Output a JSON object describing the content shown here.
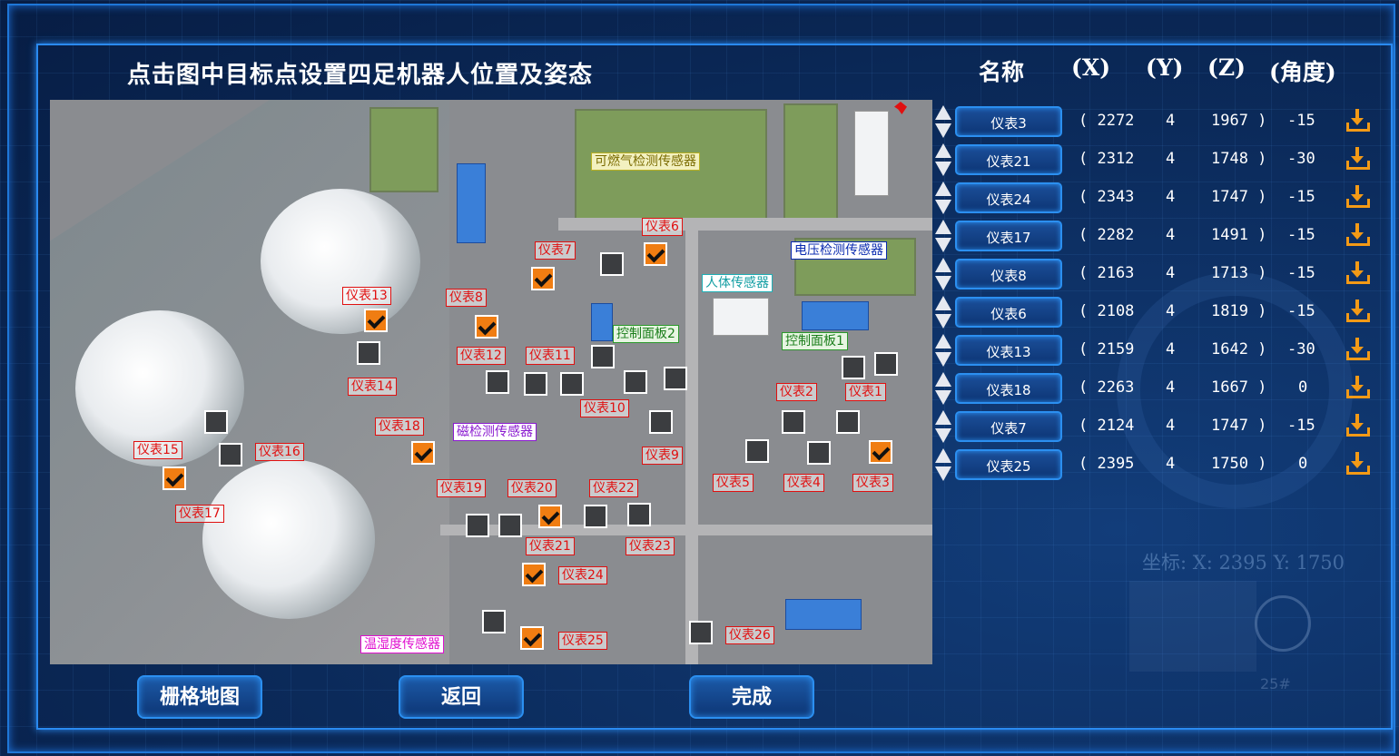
{
  "title": "点击图中目标点设置四足机器人位置及姿态",
  "table_headers": [
    "名称",
    "(X)",
    "(Y)",
    "(Z)",
    "(角度)"
  ],
  "rows": [
    {
      "name": "仪表3",
      "x": "( 2272",
      "y": "4",
      "z": "1967 )",
      "angle": "-15"
    },
    {
      "name": "仪表21",
      "x": "( 2312",
      "y": "4",
      "z": "1748 )",
      "angle": "-30"
    },
    {
      "name": "仪表24",
      "x": "( 2343",
      "y": "4",
      "z": "1747 )",
      "angle": "-15"
    },
    {
      "name": "仪表17",
      "x": "( 2282",
      "y": "4",
      "z": "1491 )",
      "angle": "-15"
    },
    {
      "name": "仪表8",
      "x": "( 2163",
      "y": "4",
      "z": "1713 )",
      "angle": "-15"
    },
    {
      "name": "仪表6",
      "x": "( 2108",
      "y": "4",
      "z": "1819 )",
      "angle": "-15"
    },
    {
      "name": "仪表13",
      "x": "( 2159",
      "y": "4",
      "z": "1642 )",
      "angle": "-30"
    },
    {
      "name": "仪表18",
      "x": "( 2263",
      "y": "4",
      "z": "1667 )",
      "angle": "0"
    },
    {
      "name": "仪表7",
      "x": "( 2124",
      "y": "4",
      "z": "1747 )",
      "angle": "-15"
    },
    {
      "name": "仪表25",
      "x": "( 2395",
      "y": "4",
      "z": "1750 )",
      "angle": "0"
    }
  ],
  "map_labels": {
    "meters": [
      "仪表1",
      "仪表2",
      "仪表3",
      "仪表4",
      "仪表5",
      "仪表6",
      "仪表7",
      "仪表8",
      "仪表9",
      "仪表10",
      "仪表11",
      "仪表12",
      "仪表13",
      "仪表14",
      "仪表15",
      "仪表16",
      "仪表17",
      "仪表18",
      "仪表19",
      "仪表20",
      "仪表21",
      "仪表22",
      "仪表23",
      "仪表24",
      "仪表25",
      "仪表26"
    ],
    "gas_sensor": "可燃气检测传感器",
    "voltage_sensor": "电压检测传感器",
    "human_sensor": "人体传感器",
    "control_panel_2": "控制面板2",
    "control_panel_1": "控制面板1",
    "magnetic_sensor": "磁检测传感器",
    "temp_humidity_sensor": "温湿度传感器"
  },
  "checked_points": [
    "仪表6",
    "仪表7",
    "仪表8",
    "仪表13",
    "仪表18",
    "仪表17",
    "仪表3",
    "仪表21",
    "仪表24",
    "仪表25"
  ],
  "coordinate_display": "坐标: X: 2395   Y: 1750",
  "deco_label": "25#",
  "buttons": {
    "grid_map": "栅格地图",
    "back": "返回",
    "done": "完成"
  },
  "colors": {
    "checked": "#f07d12",
    "unchecked": "#3b3d40",
    "frame": "#2a8af0",
    "download_icon": "#f39a16"
  }
}
